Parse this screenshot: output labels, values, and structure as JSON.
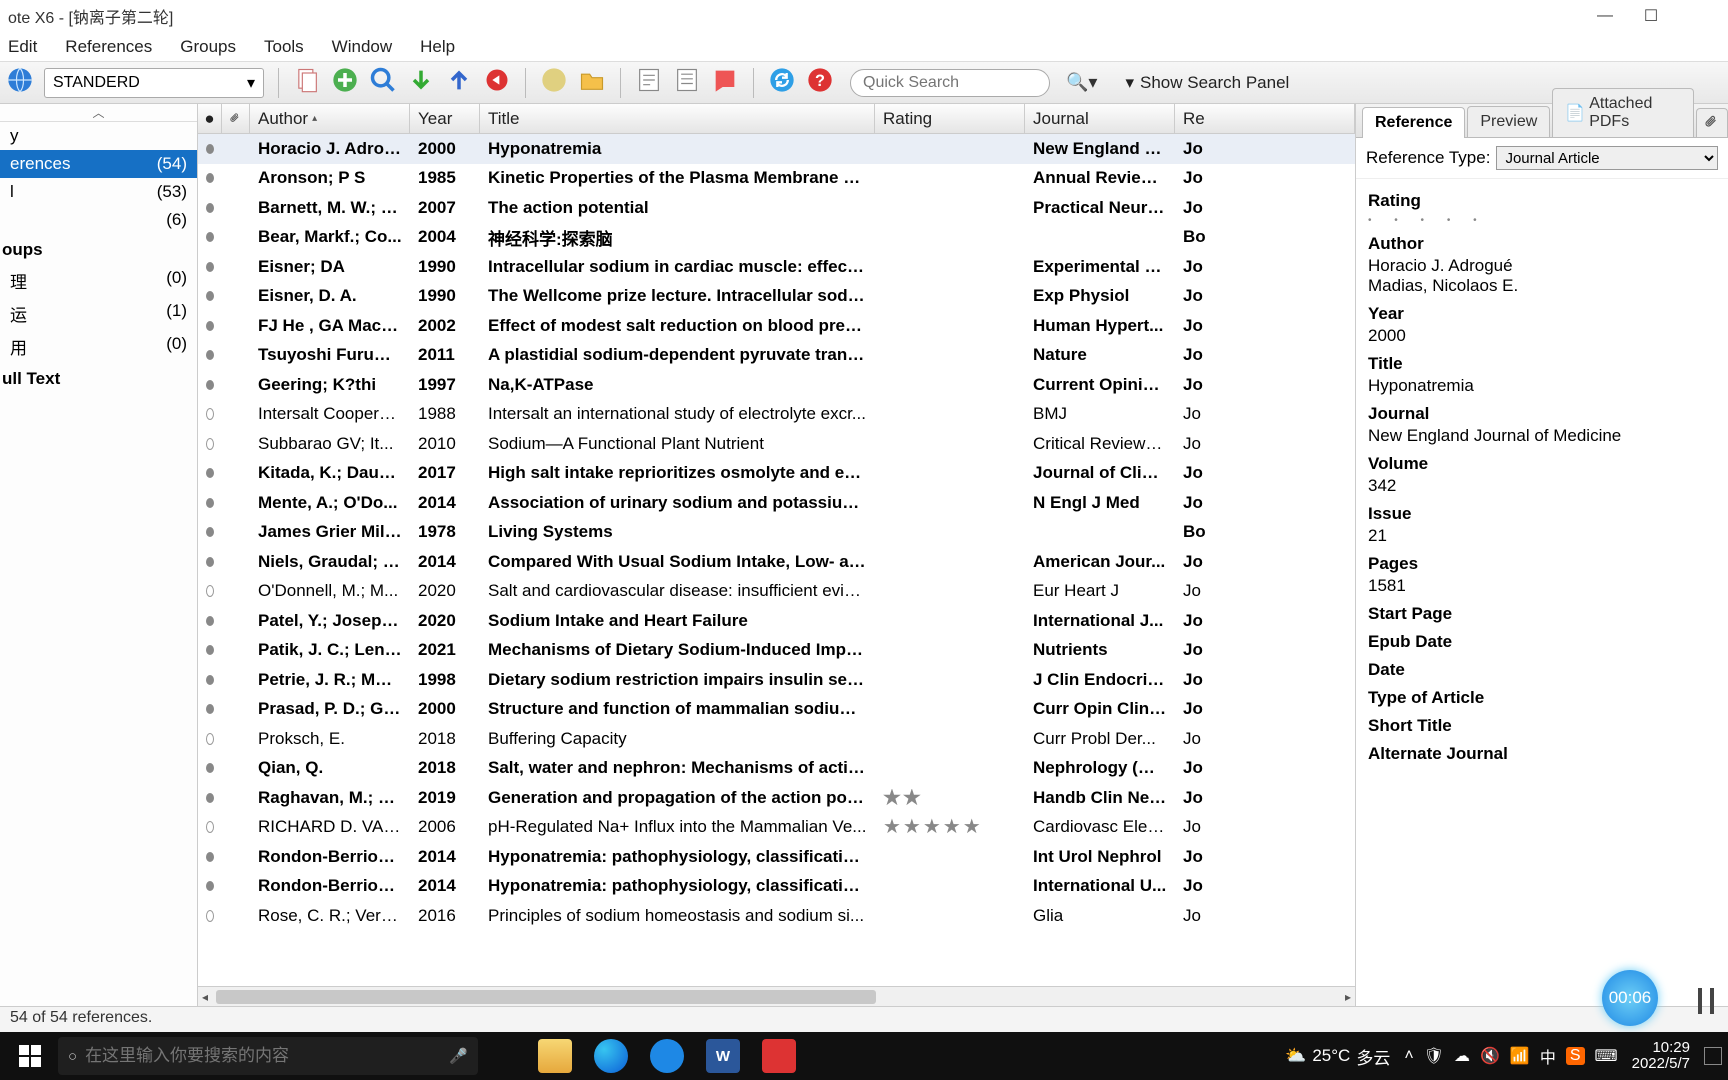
{
  "window": {
    "title": "ote X6 - [钠离子第二轮]"
  },
  "menu": [
    "Edit",
    "References",
    "Groups",
    "Tools",
    "Window",
    "Help"
  ],
  "toolbar": {
    "style": "STANDERD",
    "search_placeholder": "Quick Search",
    "show_panel": "Show Search Panel"
  },
  "sidebar": {
    "top_label": "y",
    "groups_header": "oups",
    "fulltext": "ull Text",
    "items": [
      {
        "label": "erences",
        "count": "(54)",
        "selected": true
      },
      {
        "label": "l",
        "count": "(53)"
      },
      {
        "label": "",
        "count": "(6)"
      }
    ],
    "groups": [
      {
        "label": "理",
        "count": "(0)"
      },
      {
        "label": "运",
        "count": "(1)"
      },
      {
        "label": "用",
        "count": "(0)"
      }
    ]
  },
  "columns": {
    "author": "Author",
    "year": "Year",
    "title": "Title",
    "rating": "Rating",
    "journal": "Journal",
    "ref": "Re"
  },
  "rows": [
    {
      "dot": "f",
      "author": "Horacio J. Adrog...",
      "year": "2000",
      "title": "Hyponatremia",
      "rating": "",
      "journal": "New England J...",
      "ref": "Jo",
      "bold": true,
      "selected": true
    },
    {
      "dot": "f",
      "author": "Aronson; P S",
      "year": "1985",
      "title": "Kinetic Properties of the Plasma Membrane N...",
      "journal": "Annual Review...",
      "ref": "Jo",
      "bold": true
    },
    {
      "dot": "f",
      "author": "Barnett, M. W.; L...",
      "year": "2007",
      "title": "The action potential",
      "journal": "Practical Neuro...",
      "ref": "Jo",
      "bold": true
    },
    {
      "dot": "f",
      "author": "Bear, Markf.; Co...",
      "year": "2004",
      "title": "神经科学:探索脑",
      "journal": "",
      "ref": "Bo",
      "bold": true
    },
    {
      "dot": "f",
      "author": "Eisner; DA",
      "year": "1990",
      "title": "Intracellular sodium in cardiac muscle: effects ...",
      "journal": "Experimental P...",
      "ref": "Jo",
      "bold": true
    },
    {
      "dot": "f",
      "author": "Eisner, D. A.",
      "year": "1990",
      "title": "The Wellcome prize lecture. Intracellular sodiu...",
      "journal": "Exp Physiol",
      "ref": "Jo",
      "bold": true
    },
    {
      "dot": "f",
      "author": "FJ He , GA MacG...",
      "year": "2002",
      "title": "Effect of modest salt reduction on blood press...",
      "journal": " Human Hypert...",
      "ref": "Jo",
      "bold": true
    },
    {
      "dot": "f",
      "author": "Tsuyoshi Furumo...",
      "year": "2011",
      "title": "A plastidial sodium-dependent pyruvate transp...",
      "journal": "Nature",
      "ref": "Jo",
      "bold": true
    },
    {
      "dot": "f",
      "author": "Geering; K?thi",
      "year": "1997",
      "title": "Na,K-ATPase",
      "journal": "Current Opinio...",
      "ref": "Jo",
      "bold": true
    },
    {
      "dot": "e",
      "author": "Intersalt Coopera...",
      "year": "1988",
      "title": "Intersalt an international study of electrolyte excr...",
      "journal": "BMJ",
      "ref": "Jo"
    },
    {
      "dot": "e",
      "author": " Subbarao GV;  It...",
      "year": "2010",
      "title": "Sodium—A Functional Plant Nutrient",
      "journal": "Critical Reviews ...",
      "ref": "Jo"
    },
    {
      "dot": "f",
      "author": "Kitada, K.; Daub, ...",
      "year": "2017",
      "title": "High salt intake reprioritizes osmolyte and ene...",
      "journal": "Journal of Clini...",
      "ref": "Jo",
      "bold": true
    },
    {
      "dot": "f",
      "author": "Mente, A.; O'Do...",
      "year": "2014",
      "title": "Association of urinary sodium and potassium e...",
      "journal": "N Engl J Med",
      "ref": "Jo",
      "bold": true
    },
    {
      "dot": "f",
      "author": "James Grier Miller",
      "year": "1978",
      "title": "Living Systems",
      "journal": "",
      "ref": "Bo",
      "bold": true
    },
    {
      "dot": "f",
      "author": "Niels, Graudal; J...",
      "year": "2014",
      "title": "Compared With Usual Sodium Intake, Low- an...",
      "journal": "American Jour...",
      "ref": "Jo",
      "bold": true
    },
    {
      "dot": "e",
      "author": "O'Donnell, M.; M...",
      "year": "2020",
      "title": "Salt and cardiovascular disease: insufficient evide...",
      "journal": "Eur Heart J",
      "ref": "Jo"
    },
    {
      "dot": "f",
      "author": "Patel, Y.; Joseph, J.",
      "year": "2020",
      "title": "Sodium Intake and Heart Failure",
      "journal": "International J...",
      "ref": "Jo",
      "bold": true
    },
    {
      "dot": "f",
      "author": "Patik, J. C.; Lenn...",
      "year": "2021",
      "title": "Mechanisms of Dietary Sodium-Induced Impai...",
      "journal": "Nutrients",
      "ref": "Jo",
      "bold": true
    },
    {
      "dot": "f",
      "author": "Petrie, J. R.; Mor...",
      "year": "1998",
      "title": "Dietary sodium restriction impairs insulin sensi...",
      "journal": "J Clin Endocrin...",
      "ref": "Jo",
      "bold": true
    },
    {
      "dot": "f",
      "author": "Prasad, P. D.; Gan...",
      "year": "2000",
      "title": "Structure and function of mammalian sodium-...",
      "journal": "Curr Opin Clin ...",
      "ref": "Jo",
      "bold": true
    },
    {
      "dot": "e",
      "author": "Proksch, E.",
      "year": "2018",
      "title": "Buffering Capacity",
      "journal": "Curr Probl Der...",
      "ref": "Jo"
    },
    {
      "dot": "f",
      "author": "Qian, Q.",
      "year": "2018",
      "title": "Salt, water and nephron: Mechanisms of action...",
      "journal": "Nephrology (Ca...",
      "ref": "Jo",
      "bold": true
    },
    {
      "dot": "f",
      "author": "Raghavan, M.; Fe...",
      "year": "2019",
      "title": "Generation and propagation of the action pote...",
      "rating": "★★",
      "journal": "Handb Clin Neu...",
      "ref": "Jo",
      "bold": true
    },
    {
      "dot": "e",
      "author": "RICHARD D. VAU...",
      "year": "2006",
      "title": "pH-Regulated Na+ Influx into the Mammalian Ve...",
      "rating": "★★★★★",
      "journal": "Cardiovasc Elec...",
      "ref": "Jo"
    },
    {
      "dot": "f",
      "author": "Rondon-Berrios,...",
      "year": "2014",
      "title": "Hyponatremia: pathophysiology, classification, ...",
      "journal": "Int Urol Nephrol",
      "ref": "Jo",
      "bold": true
    },
    {
      "dot": "f",
      "author": "Rondon-Berrios,...",
      "year": "2014",
      "title": "Hyponatremia: pathophysiology, classification, ...",
      "journal": "International U...",
      "ref": "Jo",
      "bold": true
    },
    {
      "dot": "e",
      "author": "Rose, C. R.; Verkh...",
      "year": "2016",
      "title": "Principles of sodium homeostasis and sodium si...",
      "journal": "Glia",
      "ref": "Jo"
    }
  ],
  "detail": {
    "tabs": {
      "reference": "Reference",
      "preview": "Preview",
      "attached": "Attached PDFs"
    },
    "reftype_label": "Reference Type:",
    "reftype_value": "Journal Article",
    "fields": [
      {
        "label": "Rating",
        "value": ""
      },
      {
        "label": "Author",
        "value": "Horacio J. Adrogué\nMadias, Nicolaos E."
      },
      {
        "label": "Year",
        "value": "2000"
      },
      {
        "label": "Title",
        "value": "Hyponatremia"
      },
      {
        "label": "Journal",
        "value": "New England Journal of Medicine"
      },
      {
        "label": "Volume",
        "value": "342"
      },
      {
        "label": "Issue",
        "value": "21"
      },
      {
        "label": "Pages",
        "value": "1581"
      },
      {
        "label": "Start Page",
        "value": ""
      },
      {
        "label": "Epub Date",
        "value": ""
      },
      {
        "label": "Date",
        "value": ""
      },
      {
        "label": "Type of Article",
        "value": ""
      },
      {
        "label": "Short Title",
        "value": ""
      },
      {
        "label": "Alternate Journal",
        "value": ""
      }
    ]
  },
  "statusbar": {
    "text": "54 of 54 references."
  },
  "timer": {
    "value": "00:06"
  },
  "taskbar": {
    "search_placeholder": "在这里输入你要搜索的内容",
    "weather": {
      "temp": "25°C",
      "cond": "多云"
    },
    "ime": "中",
    "clock": {
      "time": "10:29",
      "date": "2022/5/7"
    }
  }
}
